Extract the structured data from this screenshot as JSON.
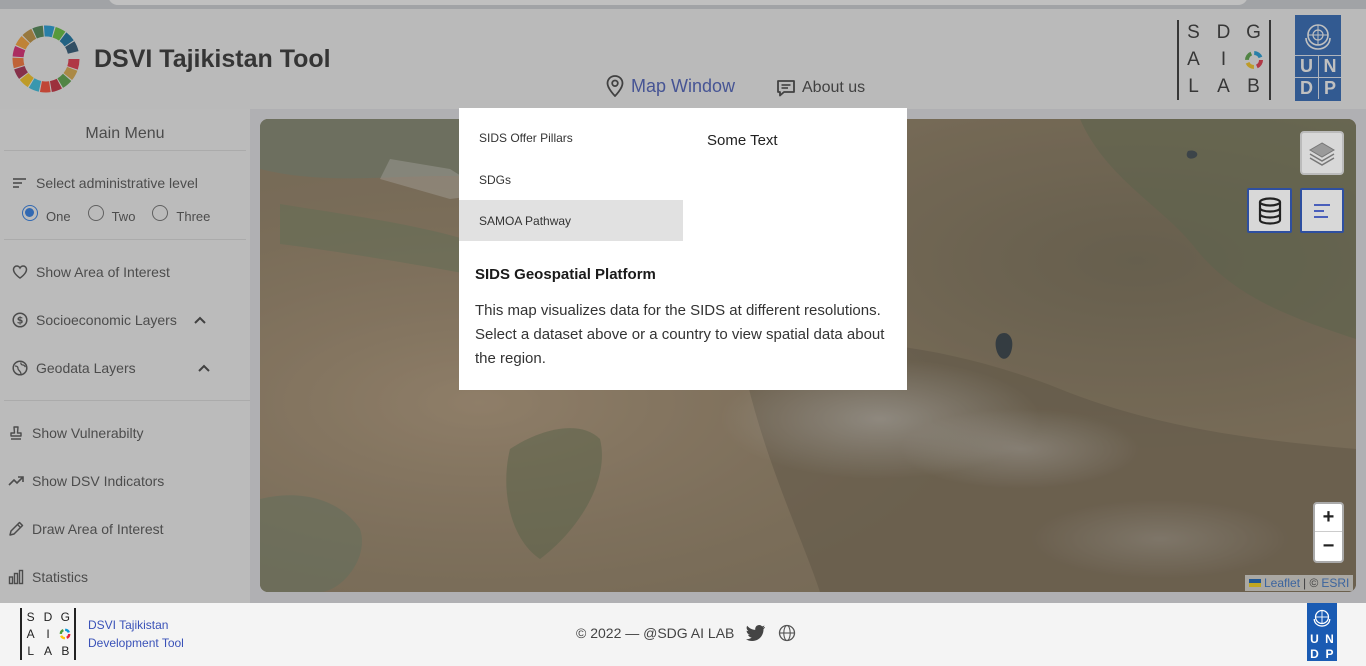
{
  "header": {
    "app_title": "DSVI Tajikistan Tool",
    "nav": {
      "map_window": "Map Window",
      "about_us": "About us"
    },
    "sdg_letters": [
      "S",
      "D",
      "G",
      "A",
      "I",
      "",
      "L",
      "A",
      "B"
    ],
    "undp_letters": [
      "U",
      "N",
      "D",
      "P"
    ]
  },
  "sidebar": {
    "menu_title": "Main Menu",
    "admin_level_label": "Select administrative level",
    "admin_levels": [
      "One",
      "Two",
      "Three"
    ],
    "selected_level": "One",
    "items": {
      "area_of_interest": "Show Area of Interest",
      "socioeconomic": "Socioeconomic Layers",
      "geodata": "Geodata Layers",
      "vulnerability": "Show Vulnerabilty",
      "dsv_indicators": "Show DSV Indicators",
      "draw_area": "Draw Area of Interest",
      "statistics": "Statistics"
    }
  },
  "panel": {
    "tabs": [
      "SIDS Offer Pillars",
      "SDGs",
      "SAMOA Pathway"
    ],
    "active_tab": "SAMOA Pathway",
    "side_text": "Some Text",
    "heading": "SIDS Geospatial Platform",
    "body": "This map visualizes data for the SIDS at different resolutions. Select a dataset above or a country to view spatial data about the region."
  },
  "map": {
    "zoom_in": "+",
    "zoom_out": "−",
    "attribution_leaflet": "Leaflet",
    "attribution_sep": "| ©",
    "attribution_esri": "ESRI"
  },
  "footer": {
    "sdg_letters": [
      "S",
      "D",
      "G",
      "A",
      "I",
      "",
      "L",
      "A",
      "B"
    ],
    "app_line1": "DSVI Tajikistan",
    "app_line2": "Development Tool",
    "copyright": "© 2022 — @SDG AI LAB",
    "undp_letters": [
      "U",
      "N",
      "D",
      "P"
    ]
  },
  "colors": {
    "accent": "#3a52b8",
    "undp_blue": "#1a5bb3",
    "radio": "#1a73e8"
  }
}
